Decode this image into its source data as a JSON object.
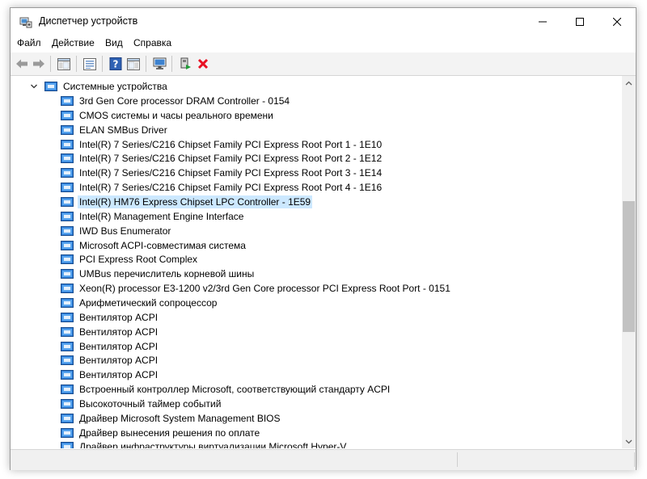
{
  "window": {
    "title": "Диспетчер устройств",
    "app_icon": "device-manager-icon",
    "controls": [
      "minimize-icon",
      "maximize-icon",
      "close-icon"
    ]
  },
  "menu": [
    "Файл",
    "Действие",
    "Вид",
    "Справка"
  ],
  "toolbar": {
    "buttons": [
      "back-arrow-icon",
      "forward-arrow-icon",
      "console-tree-icon",
      "properties-icon",
      "help-icon",
      "action-pane-icon",
      "monitor-icon",
      "enable-device-icon",
      "uninstall-icon"
    ]
  },
  "tree": {
    "category": "Системные устройства",
    "selected_index": 7,
    "items": [
      "3rd Gen Core processor DRAM Controller - 0154",
      "CMOS системы и часы реального времени",
      "ELAN SMBus Driver",
      "Intel(R) 7 Series/C216 Chipset Family PCI Express Root Port 1 - 1E10",
      "Intel(R) 7 Series/C216 Chipset Family PCI Express Root Port 2 - 1E12",
      "Intel(R) 7 Series/C216 Chipset Family PCI Express Root Port 3 - 1E14",
      "Intel(R) 7 Series/C216 Chipset Family PCI Express Root Port 4 - 1E16",
      "Intel(R) HM76 Express Chipset LPC Controller - 1E59",
      "Intel(R) Management Engine Interface",
      "IWD Bus Enumerator",
      "Microsoft ACPI-совместимая система",
      "PCI Express Root Complex",
      "UMBus перечислитель корневой шины",
      "Xeon(R) processor E3-1200 v2/3rd Gen Core processor PCI Express Root Port - 0151",
      "Арифметический сопроцессор",
      "Вентилятор ACPI",
      "Вентилятор ACPI",
      "Вентилятор ACPI",
      "Вентилятор ACPI",
      "Вентилятор ACPI",
      "Встроенный контроллер Microsoft, соответствующий стандарту ACPI",
      "Высокоточный таймер событий",
      "Драйвер Microsoft System Management BIOS",
      "Драйвер вынесения решения по оплате",
      "Драйвер инфраструктуры виртуализации Microsoft Hyper-V"
    ]
  },
  "colors": {
    "selection": "#cce8ff",
    "toolbar_bg": "#f3f3f3",
    "uninstall_red": "#e81123"
  }
}
